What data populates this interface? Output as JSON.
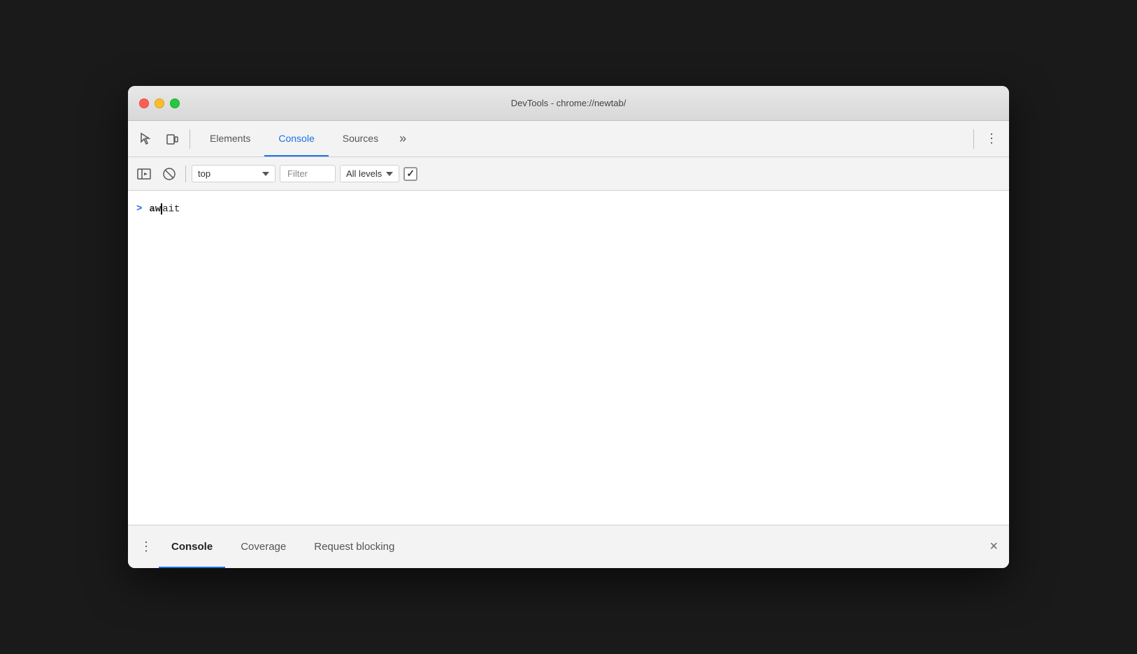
{
  "window": {
    "title": "DevTools - chrome://newtab/"
  },
  "traffic_lights": {
    "close_label": "close",
    "minimize_label": "minimize",
    "maximize_label": "maximize"
  },
  "top_toolbar": {
    "inspect_icon": "⬚",
    "device_icon": "▣",
    "tabs": [
      {
        "label": "Elements",
        "active": false
      },
      {
        "label": "Console",
        "active": true
      },
      {
        "label": "Sources",
        "active": false
      }
    ],
    "more_label": "»",
    "menu_label": "⋮"
  },
  "console_toolbar": {
    "sidebar_icon": "▷|",
    "clear_icon": "⊘",
    "context_dropdown_label": "top",
    "filter_placeholder": "Filter",
    "levels_label": "All levels",
    "checkbox_checked": true
  },
  "console_content": {
    "prompt_symbol": ">",
    "input_text_bold": "aw",
    "input_text_normal": "ait"
  },
  "bottom_panel": {
    "dots_icon": "⋮",
    "tabs": [
      {
        "label": "Console",
        "active": true
      },
      {
        "label": "Coverage",
        "active": false
      },
      {
        "label": "Request blocking",
        "active": false
      }
    ],
    "close_label": "×"
  }
}
